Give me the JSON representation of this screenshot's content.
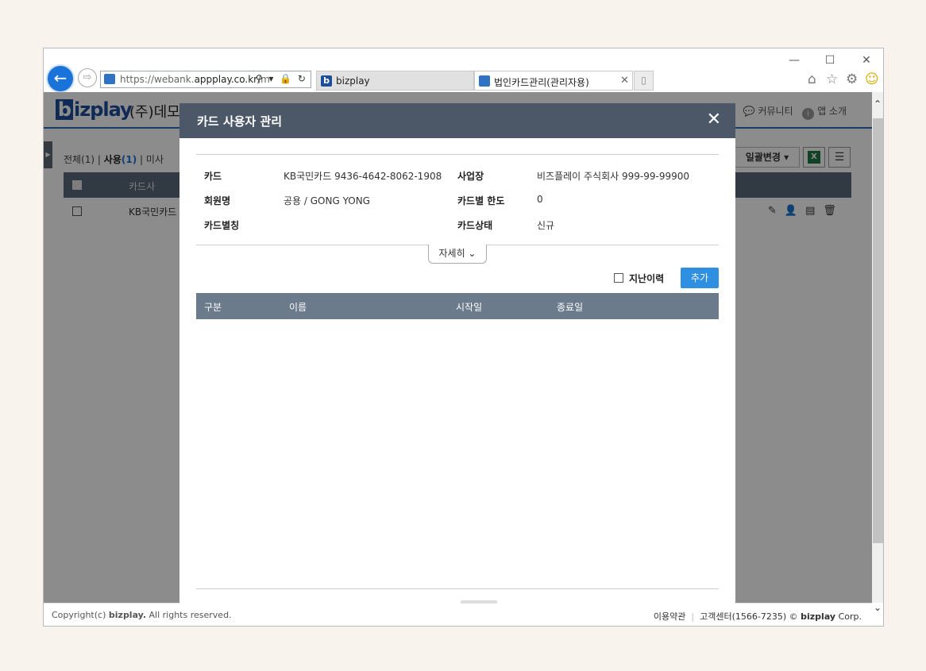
{
  "browser": {
    "url_prefix": "https://webank.",
    "url_host": "appplay.co.kr",
    "url_rest": "/m",
    "address_tools": "⚲ ▾ 🔒 ↻",
    "tabs": [
      {
        "icon": "b",
        "label": "bizplay"
      },
      {
        "icon": "▣",
        "label": "법인카드관리(관리자용)",
        "close": "✕"
      }
    ],
    "window_buttons": {
      "minimize": "—",
      "maximize": "☐",
      "close": "✕"
    },
    "toolbar_icons": [
      "home-icon",
      "star-icon",
      "gear-icon",
      "smiley-icon"
    ]
  },
  "page": {
    "logo": {
      "b": "b",
      "rest": "izplay"
    },
    "company": "(주)데모",
    "topnav": {
      "community": "커뮤니티",
      "info_icon": "i",
      "app_intro": "앱 소개"
    },
    "filters": {
      "all": "전체",
      "all_count": "(1)",
      "sep": "|",
      "in_use": "사용",
      "in_use_count": "(1)",
      "unused": "미사"
    },
    "bulk_change": "일괄변경",
    "excel_icon": "X",
    "table": {
      "header_card_co": "카드사",
      "row1_card_co": "KB국민카드"
    },
    "row_action_icons": "✎ 👤 ▤ 🗑"
  },
  "footer": {
    "copyright_prefix": "Copyright(c) ",
    "copyright_brand": "bizplay.",
    "copyright_suffix": " All rights reserved.",
    "terms": "이용약관",
    "support": "고객센터(1566-7235)",
    "corp_prefix": "© ",
    "corp_brand": "bizplay",
    "corp_suffix": " Corp."
  },
  "modal": {
    "title": "카드 사용자 관리",
    "close": "✕",
    "fields": {
      "card_label": "카드",
      "card_value": "KB국민카드 9436-4642-8062-1908",
      "business_label": "사업장",
      "business_value": "비즈플레이 주식회사 999-99-99900",
      "member_label": "회원명",
      "member_value": "공용 / GONG YONG",
      "limit_label": "카드별 한도",
      "limit_value": "0",
      "alias_label": "카드별칭",
      "alias_value": "",
      "status_label": "카드상태",
      "status_value": "신규"
    },
    "detail_button": "자세히 ⌄",
    "history_label": "지난이력",
    "add_button": "추가",
    "columns": [
      "구분",
      "이름",
      "시작일",
      "종료일"
    ]
  }
}
